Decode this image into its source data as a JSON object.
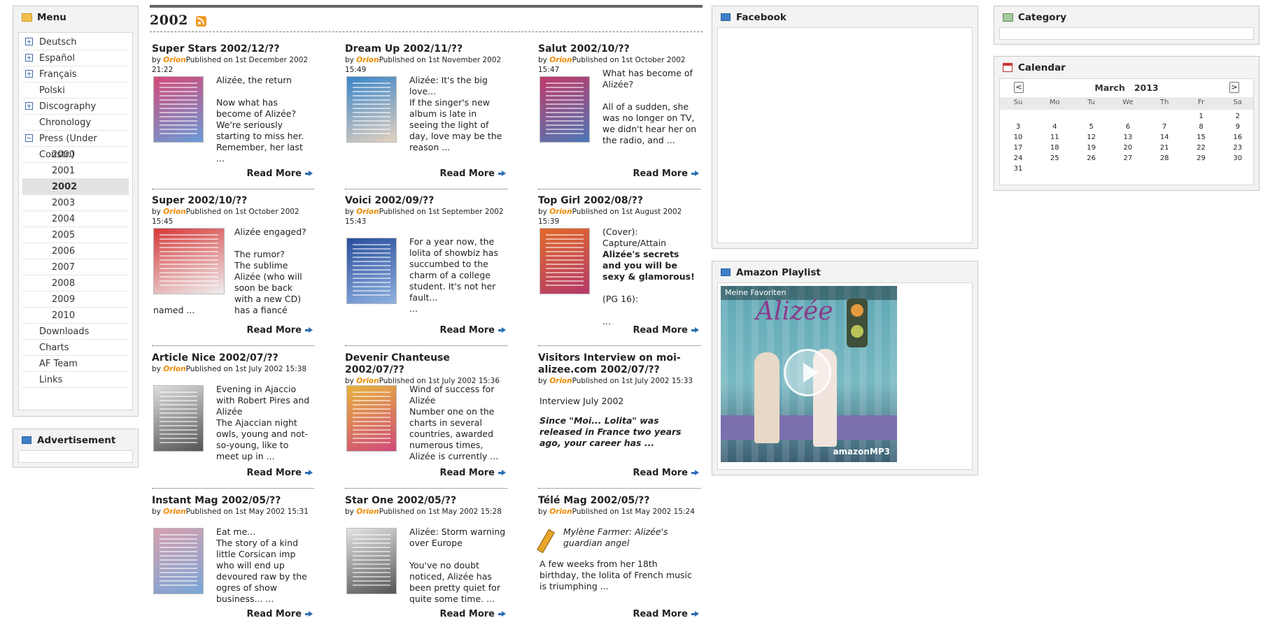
{
  "menu": {
    "title": "Menu",
    "items": [
      {
        "label": "Deutsch",
        "expander": "+"
      },
      {
        "label": "Español",
        "expander": "+"
      },
      {
        "label": "Français",
        "expander": "+"
      },
      {
        "label": "Polski",
        "expander": ""
      },
      {
        "label": "Discography",
        "expander": "+"
      },
      {
        "label": "Chronology",
        "expander": ""
      },
      {
        "label": "Press (Under Constr.)",
        "expander": "−"
      },
      {
        "label": "2000",
        "sub": true
      },
      {
        "label": "2001",
        "sub": true
      },
      {
        "label": "2002",
        "sub": true,
        "active": true
      },
      {
        "label": "2003",
        "sub": true
      },
      {
        "label": "2004",
        "sub": true
      },
      {
        "label": "2005",
        "sub": true
      },
      {
        "label": "2006",
        "sub": true
      },
      {
        "label": "2007",
        "sub": true
      },
      {
        "label": "2008",
        "sub": true
      },
      {
        "label": "2009",
        "sub": true
      },
      {
        "label": "2010",
        "sub": true
      },
      {
        "label": "Downloads",
        "expander": ""
      },
      {
        "label": "Charts",
        "expander": ""
      },
      {
        "label": "AF Team",
        "expander": ""
      },
      {
        "label": "Links",
        "expander": ""
      }
    ]
  },
  "advertisement": {
    "title": "Advertisement"
  },
  "page": {
    "title": "2002"
  },
  "read_more": "Read More",
  "articles": [
    {
      "title": "Super Stars 2002/12/??",
      "by": "by ",
      "author": "Orion",
      "published": "Published on 1st December 2002 21:22",
      "text": "Alizée, the return\n\nNow what has become of Alizée? We're seriously starting to miss her. Remember, her last ..."
    },
    {
      "title": "Dream Up 2002/11/??",
      "by": "by ",
      "author": "Orion",
      "published": "Published on 1st November 2002 15:49",
      "text": "Alizée: It's the big love...\nIf the singer's new album is late in seeing the light of day, love may be the reason ..."
    },
    {
      "title": "Salut 2002/10/??",
      "by": "by ",
      "author": "Orion",
      "published": "Published on 1st October 2002 15:47",
      "text": "What has become of Alizée?\n\nAll of a sudden, she was no longer on TV, we didn't hear her on the radio, and ..."
    },
    {
      "title": "Super 2002/10/??",
      "by": "by ",
      "author": "Orion",
      "published": "Published on 1st October 2002 15:45",
      "text": "Alizée engaged?\n\nThe rumor?\nThe sublime Alizée (who will soon be back with a new CD) has a fiancé",
      "tail": "named ..."
    },
    {
      "title": "Voici 2002/09/??",
      "by": "by ",
      "author": "Orion",
      "published": "Published on 1st September 2002 15:43",
      "text": "For a year now, the lolita of showbiz has succumbed to the charm of a college student. It's not her fault...\n..."
    },
    {
      "title": "Top Girl 2002/08/??",
      "by": "by ",
      "author": "Orion",
      "published": "Published on 1st August 2002 15:39",
      "text_pre": "(Cover):\nCapture/Attain ",
      "text_bold": "Alizée's secrets and you will be sexy & glamorous!",
      "text_post": "\n\n(PG 16):\n\n..."
    },
    {
      "title": "Article Nice 2002/07/??",
      "by": "by ",
      "author": "Orion",
      "published": "Published on 1st July 2002 15:38",
      "text": "Evening in Ajaccio with Robert Pires and Alizée\nThe Ajaccian night owls, young and not-so-young, like to meet up in ..."
    },
    {
      "title": "Devenir Chanteuse 2002/07/??",
      "by": "by ",
      "author": "Orion",
      "published": "Published on 1st July 2002 15:36",
      "text": "Wind of success for Alizée\nNumber one on the charts in several countries, awarded numerous times, Alizée is currently ..."
    },
    {
      "title": "Visitors Interview on moi-alizee.com 2002/07/??",
      "by": "by ",
      "author": "Orion",
      "published": "Published on 1st July 2002 15:33",
      "text": "Interview July 2002",
      "italic": "Since \"Moi... Lolita\" was released in France two years ago, your career has ..."
    },
    {
      "title": "Instant Mag 2002/05/??",
      "by": "by ",
      "author": "Orion",
      "published": "Published on 1st May 2002 15:31",
      "text": "Eat me...\nThe story of a kind little Corsican imp who will end up devoured raw by the ogres of show business... ..."
    },
    {
      "title": "Star One 2002/05/??",
      "by": "by ",
      "author": "Orion",
      "published": "Published on 1st May 2002 15:28",
      "text": "Alizée: Storm warning over Europe\n\nYou've no doubt noticed, Alizée has been pretty quiet for quite some time. ..."
    },
    {
      "title": "Télé Mag 2002/05/??",
      "by": "by ",
      "author": "Orion",
      "published": "Published on 1st May 2002 15:24",
      "italic": "Mylène Farmer: Alizée's guardian angel",
      "text": "A few weeks from her 18th birthday, the lolita of French music is triumphing ..."
    }
  ],
  "facebook": {
    "title": "Facebook"
  },
  "amazon": {
    "title": "Amazon Playlist",
    "widget_label": "Meine Favoriten",
    "artist_logo": "Alizée",
    "brand": "amazonMP3"
  },
  "category": {
    "title": "Category"
  },
  "calendar": {
    "title": "Calendar",
    "prev": "<",
    "next": ">",
    "month": "March",
    "year": "2013",
    "weekdays": [
      "Su",
      "Mo",
      "Tu",
      "We",
      "Th",
      "Fr",
      "Sa"
    ],
    "weeks": [
      [
        "",
        "",
        "",
        "",
        "",
        "1",
        "2"
      ],
      [
        "3",
        "4",
        "5",
        "6",
        "7",
        "8",
        "9"
      ],
      [
        "10",
        "11",
        "12",
        "13",
        "14",
        "15",
        "16"
      ],
      [
        "17",
        "18",
        "19",
        "20",
        "21",
        "22",
        "23"
      ],
      [
        "24",
        "25",
        "26",
        "27",
        "28",
        "29",
        "30"
      ],
      [
        "31",
        "",
        "",
        "",
        "",
        "",
        ""
      ]
    ]
  }
}
